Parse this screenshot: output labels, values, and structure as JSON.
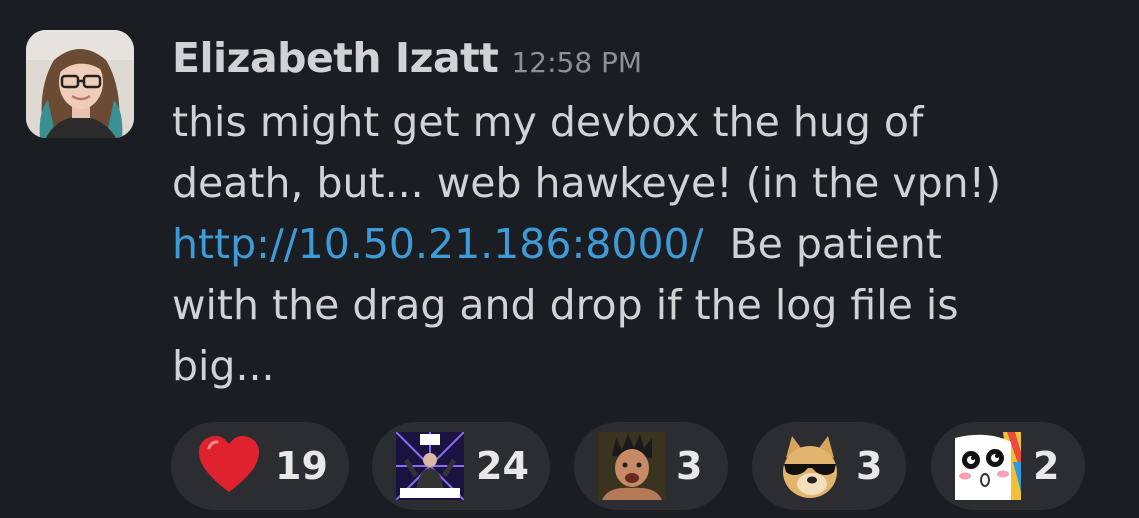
{
  "message": {
    "author": "Elizabeth Izatt",
    "timestamp": "12:58 PM",
    "text_line_1": "this might get my devbox the hug of",
    "text_line_2": "death, but... web hawkeye!  (in the vpn!)",
    "link": "http://10.50.21.186:8000/",
    "text_after_link": "  Be patient",
    "text_line_4": "with the drag and drop if the log file is",
    "text_line_5": "big..."
  },
  "reactions": [
    {
      "emoji": "heart-emoji",
      "count": "19"
    },
    {
      "emoji": "its-happening-emoji",
      "count": "24"
    },
    {
      "emoji": "pauly-d-emoji",
      "count": "3"
    },
    {
      "emoji": "doge-sunglasses-emoji",
      "count": "3"
    },
    {
      "emoji": "anime-face-emoji",
      "count": "2"
    }
  ],
  "colors": {
    "background": "#1a1d21",
    "text": "#d1d2d3",
    "timestamp": "#8e9093",
    "link": "#3f9bd8",
    "reaction_pill": "#2b2d31"
  }
}
